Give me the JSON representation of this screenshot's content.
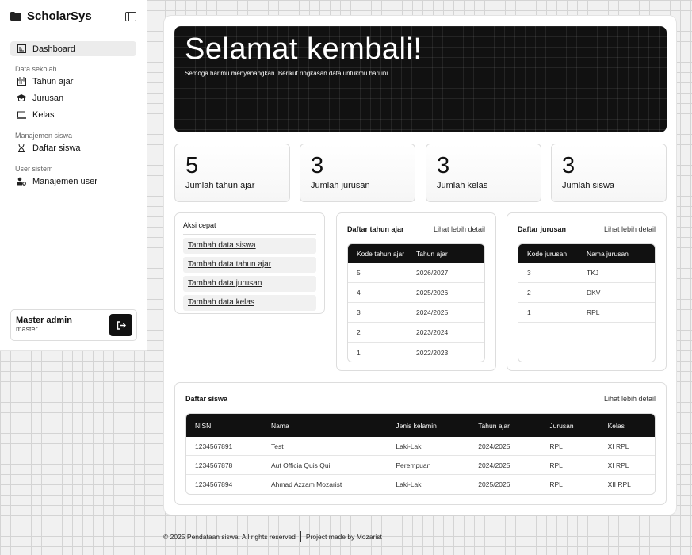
{
  "sidebar": {
    "brand": "ScholarSys",
    "dashboard": "Dashboard",
    "groups": [
      {
        "label": "Data sekolah",
        "items": [
          "Tahun ajar",
          "Jurusan",
          "Kelas"
        ]
      },
      {
        "label": "Manajemen siswa",
        "items": [
          "Daftar siswa"
        ]
      },
      {
        "label": "User sistem",
        "items": [
          "Manajemen user"
        ]
      }
    ],
    "user": {
      "name": "Master admin",
      "role": "master"
    }
  },
  "hero": {
    "title": "Selamat kembali!",
    "subtitle": "Semoga harimu menyenangkan. Berikut ringkasan data untukmu hari ini."
  },
  "stats": [
    {
      "value": "5",
      "label": "Jumlah tahun ajar"
    },
    {
      "value": "3",
      "label": "Jumlah jurusan"
    },
    {
      "value": "3",
      "label": "Jumlah kelas"
    },
    {
      "value": "3",
      "label": "Jumlah siswa"
    }
  ],
  "quick": {
    "title": "Aksi cepat",
    "links": [
      "Tambah data siswa",
      "Tambah data tahun ajar",
      "Tambah data jurusan",
      "Tambah data kelas"
    ]
  },
  "years": {
    "title": "Daftar tahun ajar",
    "more": "Lihat lebih detail",
    "headers": [
      "Kode tahun ajar",
      "Tahun ajar"
    ],
    "rows": [
      [
        "5",
        "2026/2027"
      ],
      [
        "4",
        "2025/2026"
      ],
      [
        "3",
        "2024/2025"
      ],
      [
        "2",
        "2023/2024"
      ],
      [
        "1",
        "2022/2023"
      ]
    ]
  },
  "majors": {
    "title": "Daftar jurusan",
    "more": "Lihat lebih detail",
    "headers": [
      "Kode jurusan",
      "Nama jurusan"
    ],
    "rows": [
      [
        "3",
        "TKJ"
      ],
      [
        "2",
        "DKV"
      ],
      [
        "1",
        "RPL"
      ]
    ]
  },
  "students": {
    "title": "Daftar siswa",
    "more": "Lihat lebih detail",
    "headers": [
      "NISN",
      "Nama",
      "Jenis kelamin",
      "Tahun ajar",
      "Jurusan",
      "Kelas"
    ],
    "rows": [
      [
        "1234567891",
        "Test",
        "Laki-Laki",
        "2024/2025",
        "RPL",
        "XI RPL"
      ],
      [
        "1234567878",
        "Aut Officia Quis Qui",
        "Perempuan",
        "2024/2025",
        "RPL",
        "XI RPL"
      ],
      [
        "1234567894",
        "Ahmad Azzam Mozarist",
        "Laki-Laki",
        "2025/2026",
        "RPL",
        "XII RPL"
      ]
    ]
  },
  "footer": {
    "left": "© 2025 Pendataan siswa. All rights reserved",
    "right": "Project made by Mozarist"
  }
}
